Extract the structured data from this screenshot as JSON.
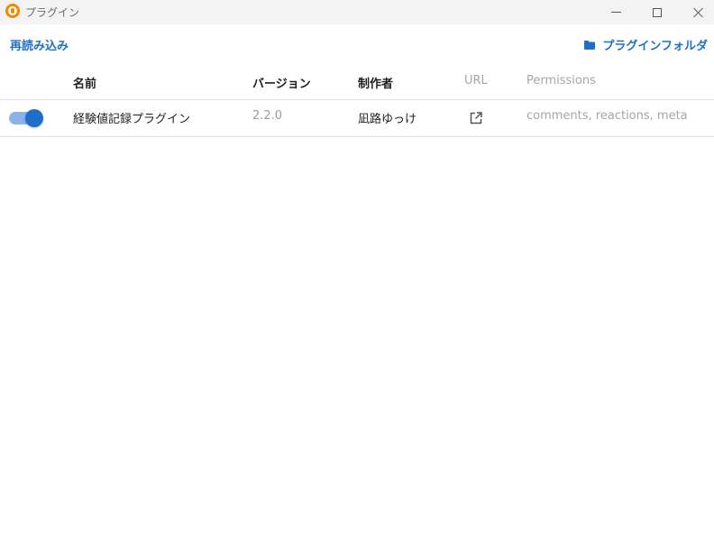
{
  "window": {
    "title": "プラグイン",
    "accent": "#f08a00"
  },
  "toolbar": {
    "reload_label": "再読み込み",
    "plugin_folder_label": "プラグインフォルダ",
    "link_color": "#1e6fc9"
  },
  "table": {
    "columns": [
      "名前",
      "バージョン",
      "制作者",
      "URL",
      "Permissions"
    ],
    "rows": [
      {
        "enabled": true,
        "name": "経験値記録プラグイン",
        "version": "2.2.0",
        "author": "凪路ゆっけ",
        "url_icon": "open-in-new-icon",
        "permissions": "comments, reactions, meta"
      }
    ]
  }
}
